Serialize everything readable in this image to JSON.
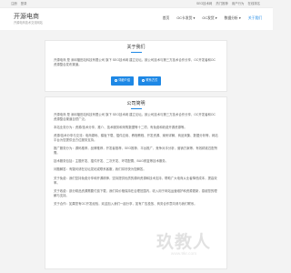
{
  "topbar": {
    "left": [
      "注册",
      "登录"
    ],
    "right": [
      "SEO技术网",
      "热门推荐",
      "用户行为",
      "在线排名"
    ]
  },
  "header": {
    "logo_title": "开源电商",
    "logo_subtitle": "开源电商技术交流网站",
    "nav": [
      "首页",
      "OC卡发货",
      "OC发货",
      "数据分析",
      "关于我们"
    ],
    "active_index": 4
  },
  "about": {
    "title": "关于我们",
    "text": "开源电商 是 深圳福田站科技有限公司 旗下 SEO技术网 建立论坛。致公司技术与第三方技术合作分享，OC开发者和OC资源整合发布渠道。",
    "buttons": [
      "详细介绍",
      "联系方式"
    ]
  },
  "desc": {
    "title": "公司简明",
    "paragraphs": [
      "开源电商 是 深圳福田站科技有限公司 旗下 SEO技术网 建立论坛。致公司技术与第三方技术合作分享，OC开发者和OC资源整合渠道自然广泛。",
      "本站业务分为：资源/技术分享、推介、技术服务和采购数据等十二项，有免费和收费开源资源等。",
      "资源/技术分享与交流：电商源码、模板下载、插件应用、教程教程、开发资源、案例详解、商品采集、数据分析等，网站平台为您提供全方位服务支持。",
      "推广服务分为：源码推荐，品牌推荐，开发者推荐，SEO推荐，平台推广，竞争对手分析，营销方案等，有效精准匹配所需。",
      "技术服务包括：主题开发、插件开发、二次开发、环境配置、BUG修复等技术服务。",
      "问题解答：有疑问请在论坛发帖或联系客服，我们将尽快为您解答。",
      "关于免费：我们坚持免费分享和开源精神，坚持提供优质的源码资源和技术支持，帮助广大电商从业者降低成本，提高效率。",
      "关于收费：部分精品资源需要付费下载，我们将价格保持在合理范围内，收入用于网站运营维护和资源更新，感谢您的理解与支持。",
      "关于合作：如果您有OC开发经验，欢迎加入我们一起分享，如有广告投放、商务合作意向请与我们联系。"
    ]
  },
  "watermark": {
    "big": "玖教人",
    "small": "www.9kr.com"
  }
}
